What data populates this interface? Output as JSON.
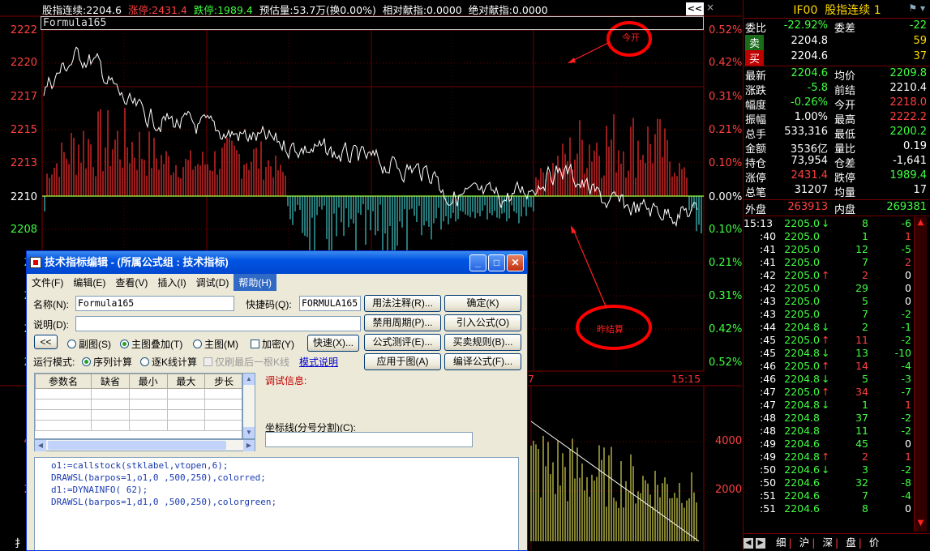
{
  "chart": {
    "stats_line": {
      "name": "股指连续:2204.6",
      "limit_up": "涨停:2431.4",
      "limit_down": "跌停:1989.4",
      "estimate": "预估量:53.7万(换0.00%)",
      "relative": "相对献指:0.0000",
      "absolute": "绝对献指:0.0000"
    },
    "nav_arrows": "<<",
    "close": "×",
    "formula_name": "Formula165",
    "y_left": [
      "2222",
      "2220",
      "2217",
      "2215",
      "2213",
      "2210",
      "2208",
      "22",
      "22",
      "22",
      "21"
    ],
    "y_right": [
      "0.52%",
      "0.42%",
      "0.31%",
      "0.21%",
      "0.10%",
      "0.00%",
      "0.10%",
      "0.21%",
      "0.31%",
      "0.42%",
      "0.52%"
    ],
    "annotation_open": "今开",
    "annotation_settle": "昨结算",
    "time_frag": "7",
    "time_label": "15:15",
    "vol_left": [
      "40",
      "20"
    ],
    "vol_right": [
      "4000",
      "2000"
    ],
    "bottom_frag": "扌",
    "colors": {
      "up": "#ff3030",
      "down": "#40c8c8",
      "price": "#ffffff",
      "volume": "#ffff60",
      "zero": "#a0ff40"
    }
  },
  "panel": {
    "code": "IF00",
    "name": "股指连续 1",
    "top_rows": [
      {
        "l1": "委比",
        "v1": "-22.92%",
        "l2": "委差",
        "v2": "-22"
      },
      {
        "l1": "卖",
        "v1": "2204.8",
        "l2": "",
        "v2": "59"
      },
      {
        "l1": "买",
        "v1": "2204.6",
        "l2": "",
        "v2": "37"
      }
    ],
    "quote_rows": [
      {
        "l1": "最新",
        "v1": "2204.6",
        "l2": "均价",
        "v2": "2209.8"
      },
      {
        "l1": "涨跌",
        "v1": "-5.8",
        "l2": "前结",
        "v2": "2210.4"
      },
      {
        "l1": "幅度",
        "v1": "-0.26%",
        "l2": "今开",
        "v2": "2218.0"
      },
      {
        "l1": "振幅",
        "v1": "1.00%",
        "l2": "最高",
        "v2": "2222.2"
      },
      {
        "l1": "总手",
        "v1": "533,316",
        "l2": "最低",
        "v2": "2200.2"
      },
      {
        "l1": "金额",
        "v1": "3536亿",
        "l2": "量比",
        "v2": "0.19"
      },
      {
        "l1": "持仓",
        "v1": "73,954",
        "l2": "仓差",
        "v2": "-1,641"
      },
      {
        "l1": "涨停",
        "v1": "2431.4",
        "l2": "跌停",
        "v2": "1989.4"
      },
      {
        "l1": "总笔",
        "v1": "31207",
        "l2": "均量",
        "v2": "17"
      }
    ],
    "outer_label": "外盘",
    "outer_value": "263913",
    "inner_label": "内盘",
    "inner_value": "269381",
    "ticks": [
      {
        "t": "15:13",
        "p": "2205.0",
        "d": "↓",
        "v": "8",
        "c": "-6"
      },
      {
        "t": ":40",
        "p": "2205.0",
        "d": "",
        "v": "1",
        "c": "1"
      },
      {
        "t": ":41",
        "p": "2205.0",
        "d": "",
        "v": "12",
        "c": "-5"
      },
      {
        "t": ":41",
        "p": "2205.0",
        "d": "",
        "v": "7",
        "c": "2"
      },
      {
        "t": ":42",
        "p": "2205.0",
        "d": "↑",
        "v": "2",
        "c": "0"
      },
      {
        "t": ":42",
        "p": "2205.0",
        "d": "",
        "v": "29",
        "c": "0"
      },
      {
        "t": ":43",
        "p": "2205.0",
        "d": "",
        "v": "5",
        "c": "0"
      },
      {
        "t": ":43",
        "p": "2205.0",
        "d": "",
        "v": "7",
        "c": "-2"
      },
      {
        "t": ":44",
        "p": "2204.8",
        "d": "↓",
        "v": "2",
        "c": "-1"
      },
      {
        "t": ":45",
        "p": "2205.0",
        "d": "↑",
        "v": "11",
        "c": "-2"
      },
      {
        "t": ":45",
        "p": "2204.8",
        "d": "↓",
        "v": "13",
        "c": "-10"
      },
      {
        "t": ":46",
        "p": "2205.0",
        "d": "↑",
        "v": "14",
        "c": "-4"
      },
      {
        "t": ":46",
        "p": "2204.8",
        "d": "↓",
        "v": "5",
        "c": "-3"
      },
      {
        "t": ":47",
        "p": "2205.0",
        "d": "↑",
        "v": "34",
        "c": "-7"
      },
      {
        "t": ":47",
        "p": "2204.8",
        "d": "↓",
        "v": "1",
        "c": "1"
      },
      {
        "t": ":48",
        "p": "2204.8",
        "d": "",
        "v": "37",
        "c": "-2"
      },
      {
        "t": ":48",
        "p": "2204.8",
        "d": "",
        "v": "11",
        "c": "-2"
      },
      {
        "t": ":49",
        "p": "2204.6",
        "d": "",
        "v": "45",
        "c": "0"
      },
      {
        "t": ":49",
        "p": "2204.8",
        "d": "↑",
        "v": "2",
        "c": "1"
      },
      {
        "t": ":50",
        "p": "2204.6",
        "d": "↓",
        "v": "3",
        "c": "-2"
      },
      {
        "t": ":50",
        "p": "2204.6",
        "d": "",
        "v": "32",
        "c": "-8"
      },
      {
        "t": ":51",
        "p": "2204.6",
        "d": "",
        "v": "7",
        "c": "-4"
      },
      {
        "t": ":51",
        "p": "2204.6",
        "d": "",
        "v": "8",
        "c": "0"
      }
    ],
    "tabs": [
      "细",
      "沪",
      "深",
      "盘",
      "价"
    ]
  },
  "dialog": {
    "title": "技术指标编辑 - (所属公式组 : 技术指标)",
    "menu": [
      "文件(F)",
      "编辑(E)",
      "查看(V)",
      "插入(I)",
      "调试(D)",
      "帮助(H)"
    ],
    "name_label": "名称(N):",
    "name_value": "Formula165",
    "shortcut_label": "快捷码(Q):",
    "shortcut_value": "FORMULA165",
    "desc_label": "说明(D):",
    "collapse_btn": "<<",
    "radio_sub": "副图(S)",
    "radio_main_overlay": "主图叠加(T)",
    "radio_main": "主图(M)",
    "encrypt": "加密(Y)",
    "quick_btn": "快速(X)...",
    "run_mode_label": "运行模式:",
    "run_serial": "序列计算",
    "run_kline": "逐K线计算",
    "only_last": "仅刷最后一根K线",
    "mode_help": "模式说明",
    "btn_annotate": "用法注释(R)...",
    "btn_disable_period": "禁用周期(P)...",
    "btn_evaluate": "公式测评(E)...",
    "btn_apply": "应用于图(A)",
    "btn_ok": "确定(K)",
    "btn_import": "引入公式(O)",
    "btn_trade_rule": "买卖规则(B)...",
    "btn_compile": "编译公式(F)...",
    "param_headers": [
      "参数名",
      "缺省",
      "最小",
      "最大",
      "步长"
    ],
    "debug_label": "调试信息:",
    "coord_label": "坐标线(分号分割)(C):",
    "code_lines": [
      "o1:=callstock(stklabel,vtopen,6);",
      "DRAWSL(barpos=1,o1,0 ,500,250),colorred;",
      "d1:=DYNAINFO( 62);",
      "DRAWSL(barpos=1,d1,0 ,500,250),colorgreen;"
    ]
  }
}
